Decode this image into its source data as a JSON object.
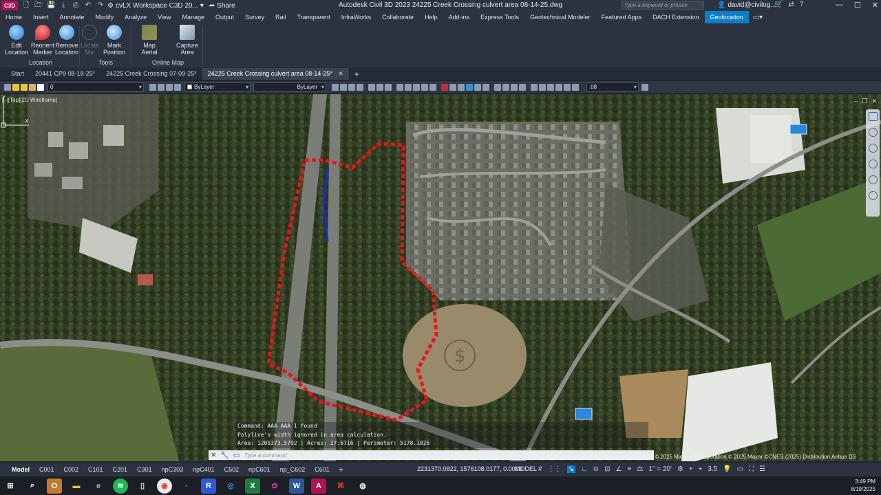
{
  "titlebar": {
    "app_logo": "C3D",
    "workspace": "cvLX Workspace C3D 20...",
    "share": "Share",
    "document_title": "Autodesk Civil 3D 2023    24225 Creek Crossing culvert area 08-14-25.dwg",
    "search_placeholder": "Type a keyword or phrase",
    "user": "david@civilog...",
    "window_controls": [
      "—",
      "☐",
      "✕"
    ]
  },
  "menu": {
    "items": [
      "Home",
      "Insert",
      "Annotate",
      "Modify",
      "Analyze",
      "View",
      "Manage",
      "Output",
      "Survey",
      "Rail",
      "Transparent",
      "InfraWorks",
      "Collaborate",
      "Help",
      "Add-ins",
      "Express Tools",
      "Geotechnical Modeler",
      "Featured Apps",
      "DACH Extension",
      "Geolocation"
    ],
    "active": "Geolocation"
  },
  "ribbon": {
    "edit_location": "Edit Location",
    "reorient_marker": "Reorient Marker",
    "remove_location": "Remove Location",
    "locate_me": "Locate Me",
    "mark_position": "Mark Position",
    "map_aerial": "Map Aerial",
    "capture_area": "Capture Area",
    "panel_location": "Location",
    "panel_tools": "Tools",
    "panel_online_map": "Online Map"
  },
  "doc_tabs": {
    "start": "Start",
    "tab1": "20441 CP9 08-18-25*",
    "tab2": "24225 Creek Crossing 07-09-25*",
    "tab3": "24225 Creek Crossing culvert area 08-14-25*",
    "active": "24225 Creek Crossing culvert area 08-14-25*"
  },
  "properties": {
    "layer": "0",
    "color": "ByLayer",
    "linetype": "ByLayer",
    "lineweight": ".08"
  },
  "viewport": {
    "label": "[–][Top][2D Wireframe]",
    "copyright": "© 2025 Microsoft Corporation © 2025 Maxar ©CNES (2025) Distribution Airbus DS"
  },
  "command": {
    "history": [
      "Command: AAA AAA 1 found",
      "Polyline's width ignored in area calculation.",
      "Area: 1205373.5792    |  Acres: 27.6716    |  Perimeter: 5178.1026"
    ],
    "placeholder": "Type a command"
  },
  "layouts": {
    "tabs": [
      "Model",
      "C001",
      "C002",
      "C101",
      "C201",
      "C301",
      "npC303",
      "npC401",
      "C502",
      "npC601",
      "np_C602",
      "C601"
    ],
    "active": "Model"
  },
  "status": {
    "coordinates": "2231370.0822, 1576108.0177, 0.0000",
    "space": "MODEL",
    "scale": "1\" = 20'",
    "zoom": "3.5"
  },
  "taskbar": {
    "time": "3:49 PM",
    "date": "8/19/2025"
  },
  "colors": {
    "accent": "#0a7ec6",
    "boundary": "#e8141e",
    "polyline": "#1a2bd6",
    "app_logo": "#b0124f"
  }
}
